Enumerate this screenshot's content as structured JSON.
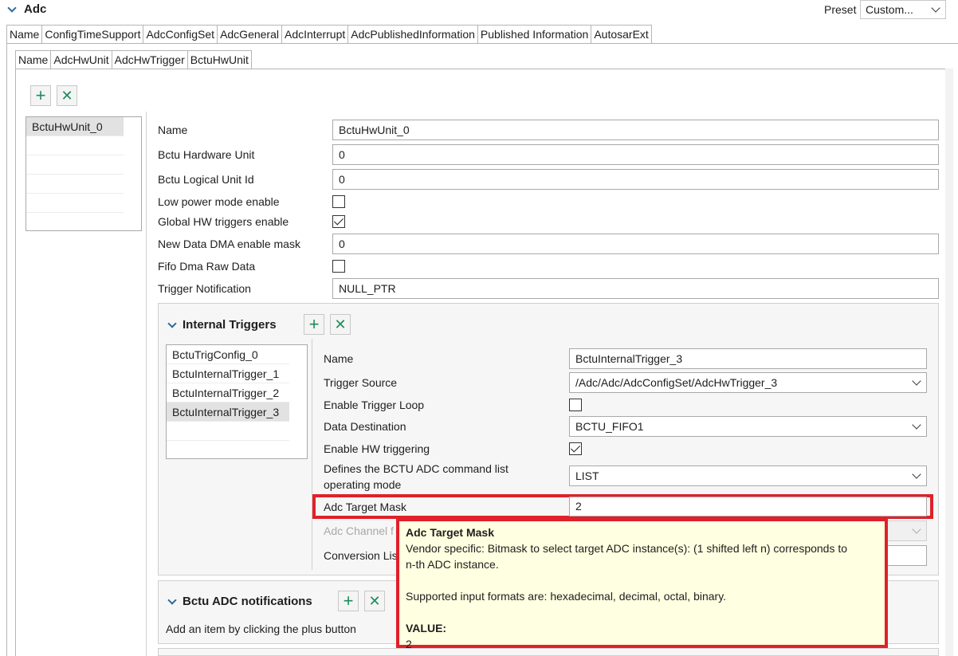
{
  "header": {
    "title": "Adc",
    "preset_label": "Preset",
    "preset_value": "Custom..."
  },
  "top_tabs": [
    "Name",
    "ConfigTimeSupport",
    "AdcConfigSet",
    "AdcGeneral",
    "AdcInterrupt",
    "AdcPublishedInformation",
    "Published Information",
    "AutosarExt"
  ],
  "sub_tabs": [
    "Name",
    "AdcHwUnit",
    "AdcHwTrigger",
    "BctuHwUnit"
  ],
  "units_list": [
    "BctuHwUnit_0"
  ],
  "unit_form": {
    "name_label": "Name",
    "name_value": "BctuHwUnit_0",
    "hw_unit_label": "Bctu Hardware Unit",
    "hw_unit_value": "0",
    "logical_id_label": "Bctu Logical Unit Id",
    "logical_id_value": "0",
    "low_power_label": "Low power mode enable",
    "global_hw_label": "Global HW triggers enable",
    "dma_mask_label": "New Data DMA enable mask",
    "dma_mask_value": "0",
    "fifo_dma_label": "Fifo Dma Raw Data",
    "trigger_notif_label": "Trigger Notification",
    "trigger_notif_value": "NULL_PTR"
  },
  "internal_triggers": {
    "title": "Internal Triggers",
    "items": [
      "BctuTrigConfig_0",
      "BctuInternalTrigger_1",
      "BctuInternalTrigger_2",
      "BctuInternalTrigger_3"
    ],
    "name_label": "Name",
    "name_value": "BctuInternalTrigger_3",
    "source_label": "Trigger Source",
    "source_value": "/Adc/Adc/AdcConfigSet/AdcHwTrigger_3",
    "loop_label": "Enable Trigger Loop",
    "dest_label": "Data Destination",
    "dest_value": "BCTU_FIFO1",
    "hw_trig_label": "Enable HW triggering",
    "cmd_mode_label_1": "Defines the BCTU ADC command list",
    "cmd_mode_label_2": "operating mode",
    "cmd_mode_value": "LIST",
    "target_mask_label": "Adc Target Mask",
    "target_mask_value": "2",
    "channel_label": "Adc Channel f",
    "conv_list_label": "Conversion Lis"
  },
  "notifications": {
    "title": "Bctu ADC notifications",
    "hint": "Add an item by clicking the plus button"
  },
  "tooltip": {
    "title": "Adc Target Mask",
    "line1": "Vendor specific: Bitmask to select target ADC instance(s): (1 shifted left n) corresponds to",
    "line2": "n-th ADC instance.",
    "line3": "Supported input formats are: hexadecimal, decimal, octal, binary.",
    "value_label": "VALUE:",
    "value": "2"
  },
  "colors": {
    "accent": "#1e8a5a",
    "highlight_border": "#e0202a",
    "tooltip_bg": "#ffffe1"
  }
}
